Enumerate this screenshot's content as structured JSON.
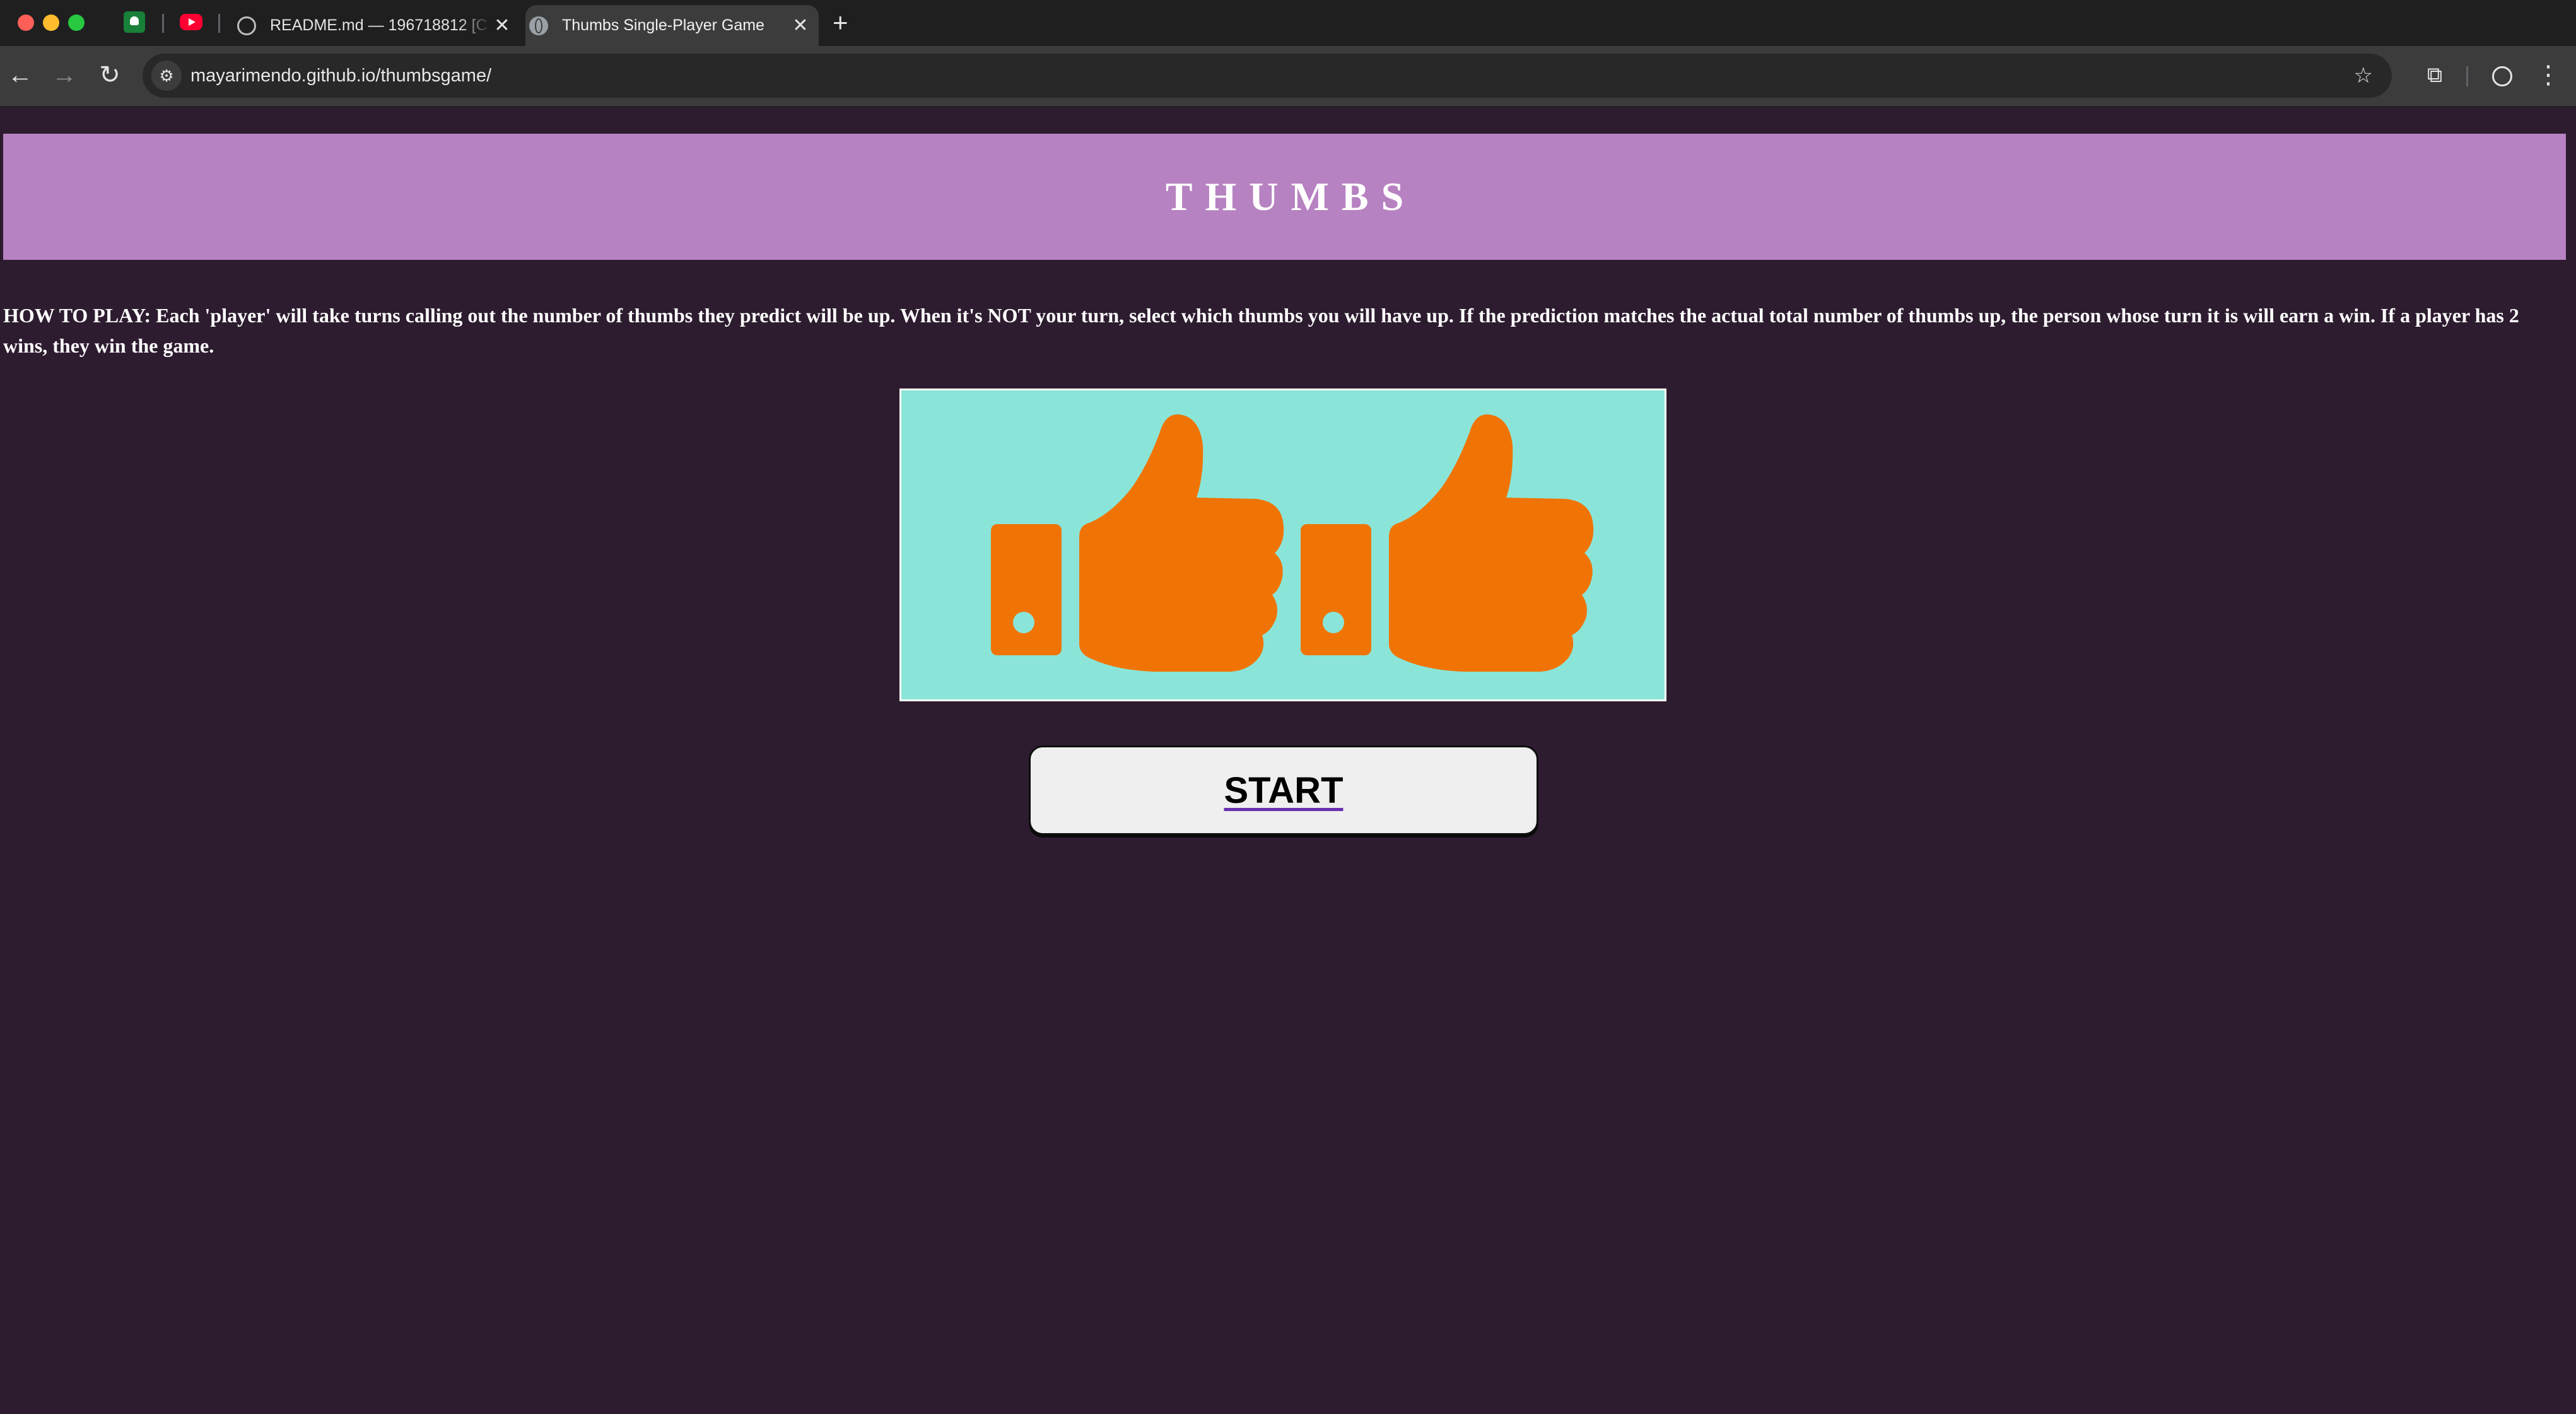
{
  "browser": {
    "tabs": [
      {
        "title": "README.md — 196718812 [C",
        "active": false
      },
      {
        "title": "Thumbs Single-Player Game",
        "active": true
      }
    ],
    "pinned_tabs": [
      "google-classroom-icon",
      "youtube-icon"
    ],
    "new_tab_label": "+",
    "url": "mayarimendo.github.io/thumbsgame/"
  },
  "page": {
    "title": "THUMBS",
    "instructions": "HOW TO PLAY: Each 'player' will take turns calling out the number of thumbs they predict will be up. When it's NOT your turn, select which thumbs you will have up. If the prediction matches the actual total number of thumbs up, the person whose turn it is will earn a win. If a player has 2 wins, they win the game.",
    "start_button": "START",
    "thumbs_image": {
      "icon": "thumbs-up-icon",
      "count": 2
    }
  },
  "colors": {
    "page_background": "#2d1c2f",
    "banner": "#b782c1",
    "thumbs_panel": "#8ae5d8",
    "thumb": "#f07405",
    "button": "#efefef"
  }
}
